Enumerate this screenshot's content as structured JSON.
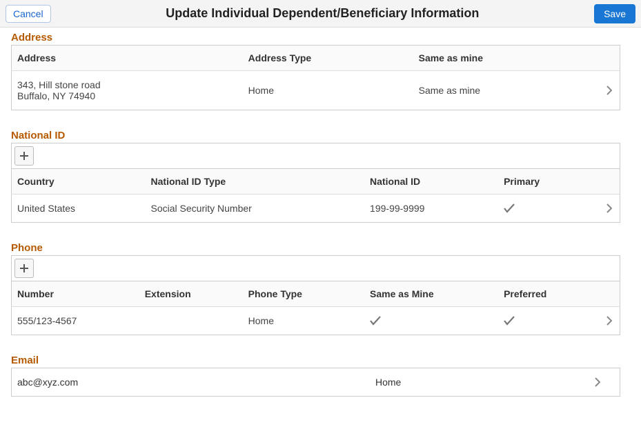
{
  "header": {
    "cancel_label": "Cancel",
    "title": "Update Individual Dependent/Beneficiary Information",
    "save_label": "Save"
  },
  "address": {
    "title": "Address",
    "columns": [
      "Address",
      "Address Type",
      "Same as mine"
    ],
    "rows": [
      {
        "address_line1": "343, Hill stone road",
        "address_line2": "Buffalo, NY 74940",
        "type": "Home",
        "same_as_mine": "Same as mine"
      }
    ]
  },
  "national_id": {
    "title": "National ID",
    "columns": [
      "Country",
      "National ID Type",
      "National ID",
      "Primary"
    ],
    "rows": [
      {
        "country": "United States",
        "id_type": "Social Security Number",
        "national_id": "199-99-9999",
        "primary": true
      }
    ]
  },
  "phone": {
    "title": "Phone",
    "columns": [
      "Number",
      "Extension",
      "Phone Type",
      "Same as Mine",
      "Preferred"
    ],
    "rows": [
      {
        "number": "555/123-4567",
        "extension": "",
        "type": "Home",
        "same_as_mine": true,
        "preferred": true
      }
    ]
  },
  "email": {
    "title": "Email",
    "address": "abc@xyz.com",
    "type": "Home"
  }
}
